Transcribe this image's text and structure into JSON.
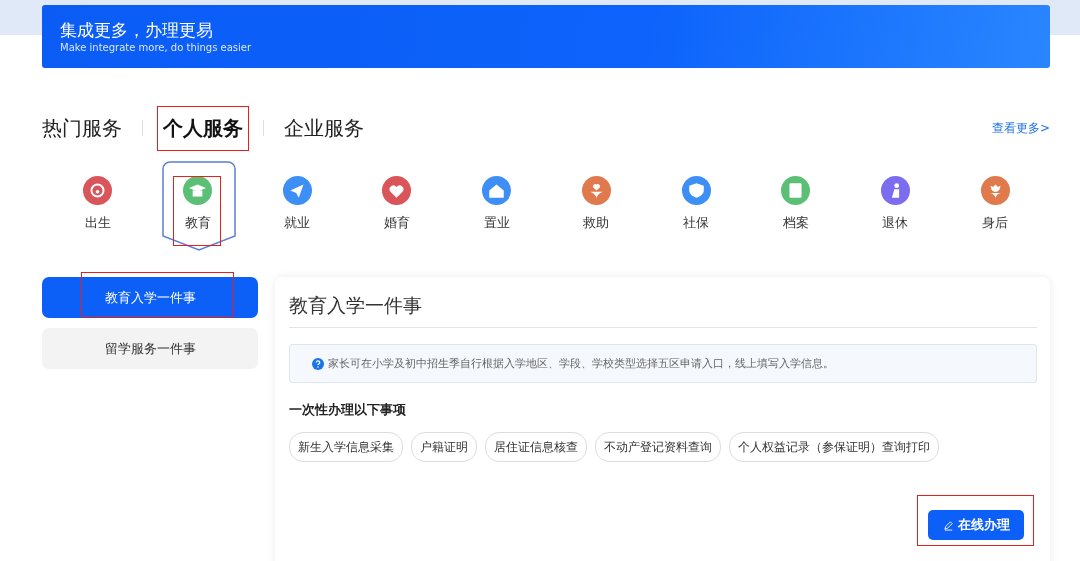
{
  "banner": {
    "title": "集成更多，办理更易",
    "subtitle": "Make integrate more, do things easier"
  },
  "tabs": [
    {
      "label": "热门服务",
      "selected": false,
      "highlighted": false
    },
    {
      "label": "个人服务",
      "selected": true,
      "highlighted": true
    },
    {
      "label": "企业服务",
      "selected": false,
      "highlighted": false
    }
  ],
  "more_link": "查看更多>",
  "categories": [
    {
      "label": "出生",
      "kind": "baby",
      "color": "#d9555a",
      "selected": false,
      "highlighted": false
    },
    {
      "label": "教育",
      "kind": "cap",
      "color": "#5cbf76",
      "selected": true,
      "highlighted": true
    },
    {
      "label": "就业",
      "kind": "plane",
      "color": "#3d8ff5",
      "selected": false,
      "highlighted": false
    },
    {
      "label": "婚育",
      "kind": "heart",
      "color": "#d9555a",
      "selected": false,
      "highlighted": false
    },
    {
      "label": "置业",
      "kind": "house",
      "color": "#3d8ff5",
      "selected": false,
      "highlighted": false
    },
    {
      "label": "救助",
      "kind": "hands",
      "color": "#e07a4c",
      "selected": false,
      "highlighted": false
    },
    {
      "label": "社保",
      "kind": "shield",
      "color": "#3d8ff5",
      "selected": false,
      "highlighted": false
    },
    {
      "label": "档案",
      "kind": "book",
      "color": "#5cbf76",
      "selected": false,
      "highlighted": false
    },
    {
      "label": "退休",
      "kind": "elder",
      "color": "#7b6cf0",
      "selected": false,
      "highlighted": false
    },
    {
      "label": "身后",
      "kind": "flower",
      "color": "#e07a4c",
      "selected": false,
      "highlighted": false
    }
  ],
  "side_items": [
    {
      "label": "教育入学一件事",
      "selected": true,
      "highlighted": true
    },
    {
      "label": "留学服务一件事",
      "selected": false,
      "highlighted": false
    }
  ],
  "panel": {
    "title": "教育入学一件事",
    "notice": "家长可在小学及初中招生季自行根据入学地区、学段、学校类型选择五区申请入口，线上填写入学信息。",
    "section_heading": "一次性办理以下事项",
    "tags": [
      "新生入学信息采集",
      "户籍证明",
      "居住证信息核查",
      "不动产登记资料查询",
      "个人权益记录（参保证明）查询打印"
    ],
    "button": {
      "label": "在线办理",
      "highlighted": true
    }
  }
}
